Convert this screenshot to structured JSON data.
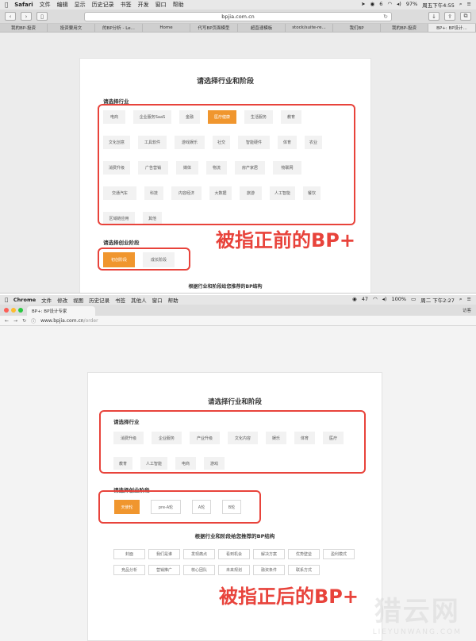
{
  "top": {
    "menubar": {
      "apple": "",
      "items": [
        "Safari",
        "文件",
        "编辑",
        "显示",
        "历史记录",
        "书签",
        "开发",
        "窗口",
        "帮助"
      ],
      "status": [
        "6",
        "97%",
        "周五下午4:55"
      ]
    },
    "address": "bpjia.com.cn",
    "tabs": [
      "我的BP-投资",
      "投资要用文",
      "的BP分析 - Le...",
      "Home",
      "代写BP页面模型",
      "超直速模板",
      "stock/suite-re...",
      "我们BP",
      "我的BP-投资",
      "BP+: BP设计..."
    ],
    "card": {
      "title": "请选择行业和阶段",
      "industry_label": "请选择行业",
      "industries": [
        "电商",
        "企业服务SaaS",
        "金融",
        "医疗健康",
        "生活服务",
        "教育",
        "文化创意",
        "工具软件",
        "游戏娱乐",
        "社交",
        "智能硬件",
        "体育",
        "农业",
        "消费升级",
        "广告营销",
        "媒体",
        "物流",
        "房产家居",
        "物联网",
        "交通汽车",
        "科技",
        "内容经济",
        "大数据",
        "旅游",
        "人工智能",
        "餐饮",
        "区域链应用",
        "其他"
      ],
      "industry_selected": "医疗健康",
      "stage_label": "请选择创业阶段",
      "stages": [
        "初创阶段",
        "成长阶段"
      ],
      "stage_selected": "初创阶段",
      "footer": "根据行业和阶段给您推荐的BP结构"
    },
    "annotation": "被指正前的BP+"
  },
  "bottom": {
    "menubar": {
      "items": [
        "Chrome",
        "文件",
        "修改",
        "视图",
        "历史记录",
        "书签",
        "其他人",
        "窗口",
        "帮助"
      ],
      "status": [
        "47",
        "100%",
        "周二 下午2:27"
      ]
    },
    "tab_title": "BP+: BP设计专家",
    "user": "访客",
    "url_host": "www.bpjia.com.cn",
    "url_path": "/order",
    "card": {
      "title": "请选择行业和阶段",
      "industry_label": "请选择行业",
      "industries": [
        "消费升级",
        "企业服务",
        "产业升级",
        "文化内容",
        "娱乐",
        "体育",
        "医疗",
        "教育",
        "人工智能",
        "电商",
        "游戏"
      ],
      "stage_label": "请选择创业阶段",
      "stages": [
        "天使轮",
        "pre-A轮",
        "A轮",
        "B轮"
      ],
      "stage_selected": "天使轮",
      "structure_title": "根据行业和阶段给您推荐的BP结构",
      "structure_row1": [
        "封面",
        "我们是谁",
        "发现痛点",
        "看到机会",
        "解决方案",
        "优势壁垒",
        "盈利模式"
      ],
      "structure_row2": [
        "竞品分析",
        "营销推广",
        "核心团队",
        "未来规划",
        "融资条件",
        "联系方式"
      ]
    },
    "annotation": "被指正后的BP+",
    "watermark": {
      "big": "猎云网",
      "small": "LIEYUNWANG.COM"
    }
  },
  "colors": {
    "accent": "#f0962e",
    "annotation": "#e8433b"
  }
}
